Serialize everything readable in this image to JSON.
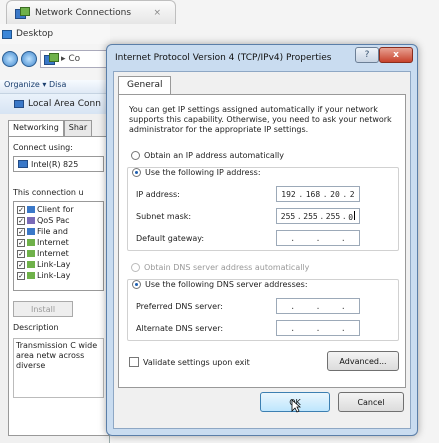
{
  "background": {
    "tab_title": "Network Connections",
    "tab_close": "×",
    "desktop_label": "Desktop",
    "address_text": "▸ Co",
    "organize_label": "Organize ▾   Disa",
    "lac": {
      "title": "Local Area Conn",
      "tabs": [
        "Networking",
        "Shar"
      ],
      "connect_using_label": "Connect using:",
      "adapter_name": "Intel(R) 825",
      "connection_uses_label": "This connection u",
      "items": [
        "Client for",
        "QoS Pac",
        "File and",
        "Internet",
        "Internet",
        "Link-Lay",
        "Link-Lay"
      ],
      "install_label": "Install",
      "description_label": "Description",
      "description_text": "Transmission C wide area netw across diverse"
    }
  },
  "dialog": {
    "title": "Internet Protocol Version 4 (TCP/IPv4) Properties",
    "help_label": "?",
    "close_label": "x",
    "tab_general": "General",
    "intro_text": "You can get IP settings assigned automatically if your network supports this capability. Otherwise, you need to ask your network administrator for the appropriate IP settings.",
    "obtain_ip_auto": "Obtain an IP address automatically",
    "use_following_ip": "Use the following IP address:",
    "ip_address_label": "IP address:",
    "ip_address": [
      "192",
      "168",
      "20",
      "2"
    ],
    "subnet_mask_label": "Subnet mask:",
    "subnet_mask": [
      "255",
      "255",
      "255",
      "0"
    ],
    "default_gateway_label": "Default gateway:",
    "obtain_dns_auto": "Obtain DNS server address automatically",
    "use_following_dns": "Use the following DNS server addresses:",
    "preferred_dns_label": "Preferred DNS server:",
    "alternate_dns_label": "Alternate DNS server:",
    "validate_label": "Validate settings upon exit",
    "advanced_label": "Advanced...",
    "ok_label": "OK",
    "cancel_label": "Cancel",
    "ip_mode": "manual",
    "dns_mode": "manual"
  }
}
